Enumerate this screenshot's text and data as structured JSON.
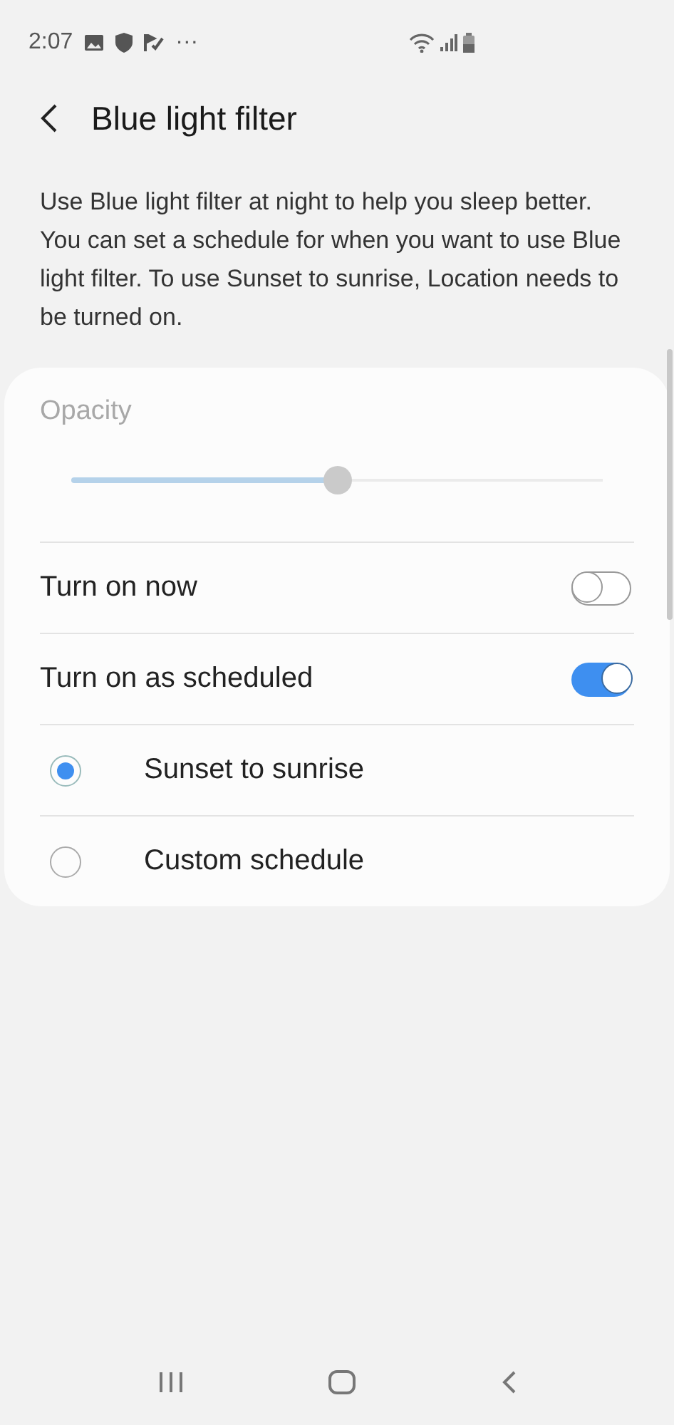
{
  "status_bar": {
    "time": "2:07",
    "more": "···"
  },
  "header": {
    "title": "Blue light filter"
  },
  "description": "Use Blue light filter at night to help you sleep better. You can set a schedule for when you want to use Blue light filter. To use Sunset to sunrise, Location needs to be turned on.",
  "opacity": {
    "label": "Opacity",
    "level": 0.5,
    "disabled": true
  },
  "switches": [
    {
      "label": "Turn on now",
      "on": false
    },
    {
      "label": "Turn on as scheduled",
      "on": true
    }
  ],
  "schedule_options": [
    {
      "label": "Sunset to sunrise",
      "selected": true
    },
    {
      "label": "Custom schedule",
      "selected": false
    }
  ]
}
